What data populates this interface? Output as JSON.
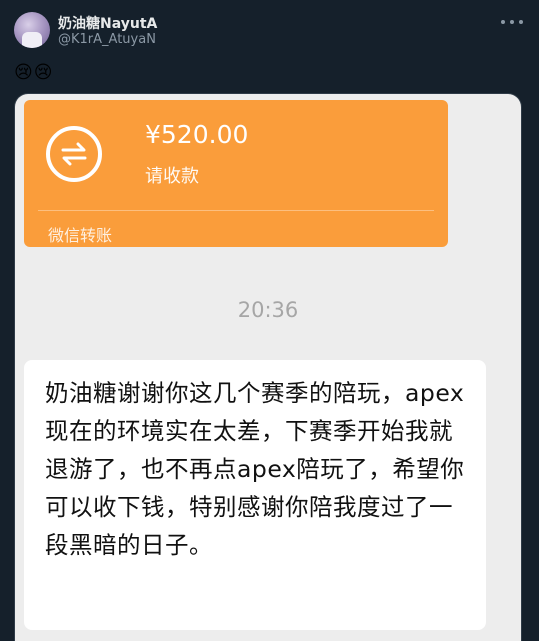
{
  "tweet": {
    "display_name": "奶油糖NayutA",
    "handle": "@K1rA_AtuyaN",
    "text": "😢😢"
  },
  "screenshot": {
    "transfer": {
      "amount": "¥520.00",
      "status": "请收款",
      "label": "微信转账",
      "accent_color": "#fa9d3b"
    },
    "timestamp": "20:36",
    "message": "奶油糖谢谢你这几个赛季的陪玩，apex现在的环境实在太差，下赛季开始我就退游了，也不再点apex陪玩了，希望你可以收下钱，特别感谢你陪我度过了一段黑暗的日子。"
  },
  "icons": [
    "more-icon",
    "transfer-arrows-icon"
  ],
  "colors": {
    "background": "#15202b",
    "photo_background": "#ededed",
    "bubble": "#ffffff"
  }
}
